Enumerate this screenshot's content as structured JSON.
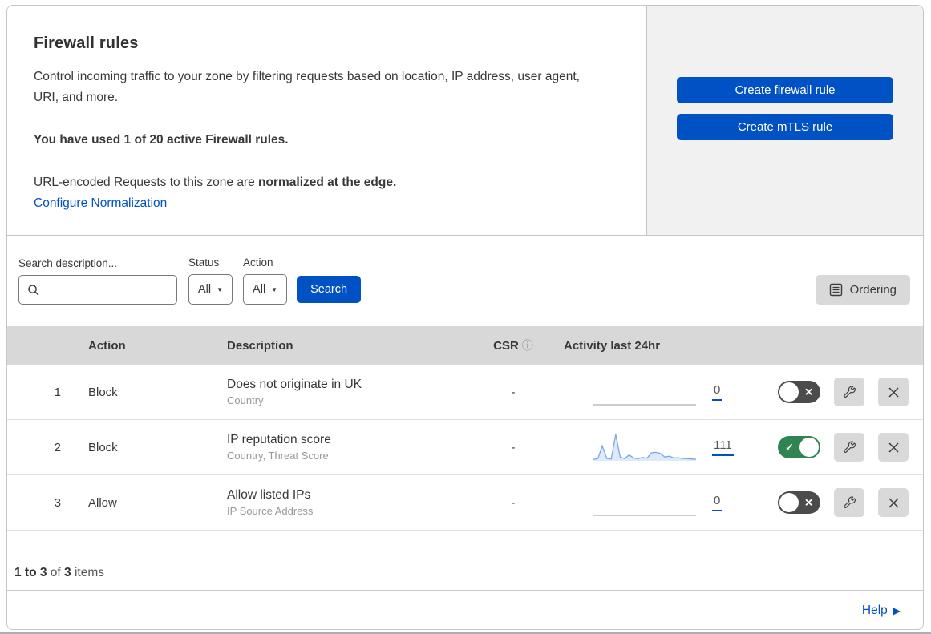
{
  "header": {
    "title": "Firewall rules",
    "description": "Control incoming traffic to your zone by filtering requests based on location, IP address, user agent, URI, and more.",
    "usage_notice": "You have used 1 of 20 active Firewall rules.",
    "normalization_prefix": "URL-encoded Requests to this zone are ",
    "normalization_bold": "normalized at the edge.",
    "normalization_link": "Configure Normalization"
  },
  "actions_panel": {
    "create_firewall_label": "Create firewall rule",
    "create_mtls_label": "Create mTLS rule"
  },
  "filters": {
    "search_label": "Search description...",
    "search_value": "",
    "status_label": "Status",
    "status_value": "All",
    "action_label": "Action",
    "action_value": "All",
    "search_button_label": "Search",
    "ordering_button_label": "Ordering"
  },
  "table": {
    "columns": {
      "action": "Action",
      "description": "Description",
      "csr": "CSR",
      "activity": "Activity last 24hr"
    },
    "rows": [
      {
        "number": "1",
        "action": "Block",
        "description": "Does not originate in UK",
        "criteria": "Country",
        "csr": "-",
        "enabled": false,
        "activity": {
          "count": "0",
          "points": [
            0,
            0,
            0,
            0,
            0,
            0,
            0,
            0,
            0,
            0,
            0,
            0,
            0,
            0,
            0,
            0,
            0,
            0,
            0,
            0,
            0,
            0,
            0,
            0
          ]
        }
      },
      {
        "number": "2",
        "action": "Block",
        "description": "IP reputation score",
        "criteria": "Country, Threat Score",
        "csr": "-",
        "enabled": true,
        "activity": {
          "count": "111",
          "points": [
            2,
            6,
            55,
            6,
            4,
            100,
            12,
            5,
            20,
            8,
            5,
            10,
            7,
            28,
            30,
            26,
            12,
            15,
            8,
            9,
            6,
            5,
            4,
            3
          ]
        }
      },
      {
        "number": "3",
        "action": "Allow",
        "description": "Allow listed IPs",
        "criteria": "IP Source Address",
        "csr": "-",
        "enabled": false,
        "activity": {
          "count": "0",
          "points": [
            0,
            0,
            0,
            0,
            0,
            0,
            0,
            0,
            0,
            0,
            0,
            0,
            0,
            0,
            0,
            0,
            0,
            0,
            0,
            0,
            0,
            0,
            0,
            0
          ]
        }
      }
    ]
  },
  "footer": {
    "range": "1 to 3",
    "of_word": "of",
    "total": "3",
    "items_word": "items",
    "help_label": "Help"
  },
  "icons": {
    "dropdown_arrow": "▼",
    "info": "ⓘ",
    "toggle_on_check": "✓",
    "toggle_off_x": "✕",
    "help_caret": "▶"
  },
  "colors": {
    "accent_blue": "#0051c3",
    "toggle_on_green": "#2f8452",
    "toggle_off_gray": "#4b4b4b",
    "spark_line_blue": "#7aa7e8",
    "spark_fill_blue": "rgba(122,167,232,0.25)",
    "spark_flat_gray": "#9a9a9a",
    "table_header_gray": "#d8d8d8",
    "panel_gray": "#f1f1f1",
    "button_gray": "#d9d9d9"
  }
}
